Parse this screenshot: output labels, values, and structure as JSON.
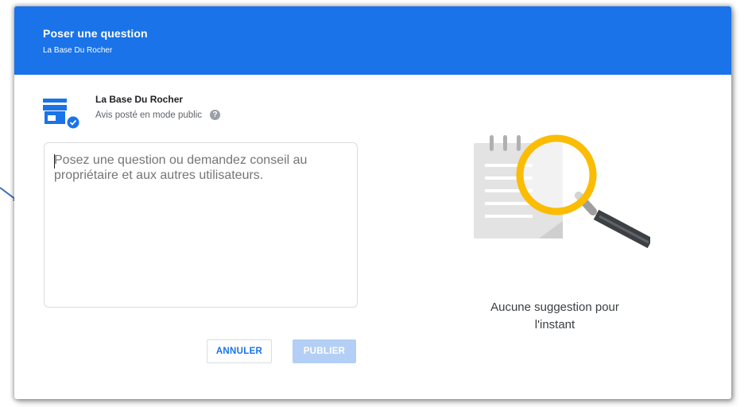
{
  "dialog": {
    "title": "Poser une question",
    "subtitle": "La Base Du Rocher"
  },
  "business": {
    "name": "La Base Du Rocher",
    "visibility": "Avis posté en mode public",
    "help_glyph": "?"
  },
  "question": {
    "placeholder": "Posez une question ou demandez conseil au propriétaire et aux autres utilisateurs.",
    "value": ""
  },
  "actions": {
    "cancel_label": "ANNULER",
    "publish_label": "PUBLIER"
  },
  "suggestions": {
    "empty_line1": "Aucune suggestion pour",
    "empty_line2": "l'instant"
  },
  "colors": {
    "header": "#1a73e8",
    "publish_disabled": "#b4cff5",
    "magnifier_ring": "#fbbc04"
  },
  "icons": {
    "business": "storefront-verified-icon",
    "help": "help-circle-icon",
    "illustration": "magnifier-notepad-icon",
    "annotation": "arrow-icon"
  }
}
